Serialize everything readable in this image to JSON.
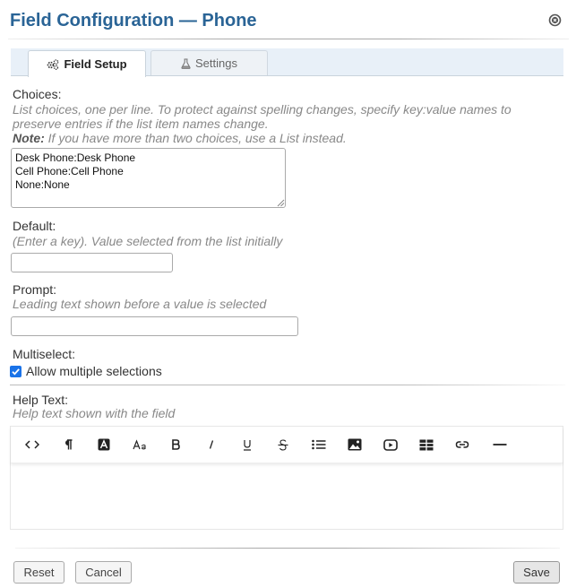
{
  "dialog": {
    "title": "Field Configuration — Phone",
    "close_icon": "close-circle-icon"
  },
  "tabs": [
    {
      "label": "Field Setup",
      "icon": "gears-icon",
      "active": true
    },
    {
      "label": "Settings",
      "icon": "flask-icon",
      "active": false
    }
  ],
  "choices": {
    "label": "Choices:",
    "hint_line1": "List choices, one per line. To protect against spelling changes, specify key:value names to",
    "hint_line2": "preserve entries if the list item names change.",
    "note_prefix": "Note:",
    "note_text": " If you have more than two choices, use a List instead.",
    "value": "Desk Phone:Desk Phone\nCell Phone:Cell Phone\nNone:None"
  },
  "default": {
    "label": "Default:",
    "hint": "(Enter a key). Value selected from the list initially",
    "value": ""
  },
  "prompt": {
    "label": "Prompt:",
    "hint": "Leading text shown before a value is selected",
    "value": ""
  },
  "multiselect": {
    "label": "Multiselect:",
    "checkbox_label": "Allow multiple selections",
    "checked": true
  },
  "help_text": {
    "label": "Help Text:",
    "hint": "Help text shown with the field",
    "toolbar": [
      {
        "name": "code-view-icon"
      },
      {
        "name": "paragraph-icon"
      },
      {
        "name": "text-color-icon"
      },
      {
        "name": "font-size-icon"
      },
      {
        "name": "bold-icon"
      },
      {
        "name": "italic-icon"
      },
      {
        "name": "underline-icon"
      },
      {
        "name": "strikethrough-icon"
      },
      {
        "name": "bullet-list-icon"
      },
      {
        "name": "image-icon"
      },
      {
        "name": "video-icon"
      },
      {
        "name": "table-icon"
      },
      {
        "name": "link-icon"
      },
      {
        "name": "horizontal-rule-icon"
      }
    ]
  },
  "footer": {
    "reset_label": "Reset",
    "cancel_label": "Cancel",
    "save_label": "Save"
  },
  "colors": {
    "title": "#2a6496",
    "checkbox": "#1a73e8",
    "tab_bar": "#e8f0f8"
  }
}
